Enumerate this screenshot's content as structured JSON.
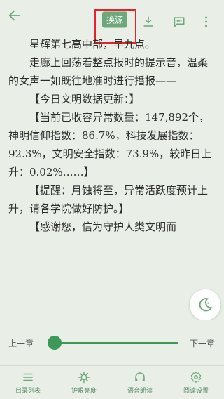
{
  "topbar": {
    "source_label": "换源"
  },
  "content": {
    "paragraphs": [
      "星辉第七高中部，早九点。",
      "走廊上回荡着整点报时的提示音，温柔的女声一如既往地准时进行播报——",
      "【今日文明数据更新：】",
      "【当前已收容异常数量：147,892个，神明信仰指数：86.7%，科技发展指数：92.3%，文明安全指数：73.9%，较昨日上升：0.02%……】",
      "【提醒：月蚀将至，异常活跃度预计上升，请各学院做好防护。】",
      "【感谢您，信为守护人类文明而"
    ]
  },
  "reader": {
    "progress": 0.0,
    "prev_label": "上一章",
    "next_label": "下一章"
  },
  "nav": {
    "items": [
      {
        "label": "目录列表",
        "icon": "list-icon"
      },
      {
        "label": "护眼亮度",
        "icon": "brightness-icon"
      },
      {
        "label": "语音朗读",
        "icon": "headphones-icon"
      },
      {
        "label": "阅读设置",
        "icon": "gear-icon"
      }
    ]
  },
  "colors": {
    "accent": "#3d9957",
    "highlight": "#e0262b",
    "background": "#e9efe7"
  }
}
